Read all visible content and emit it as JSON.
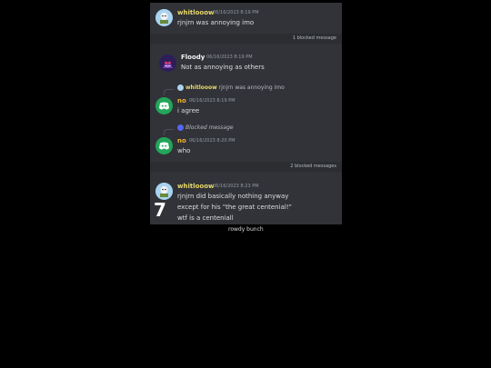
{
  "messages": [
    {
      "author": "whitlooow",
      "timestamp": "06/16/2023 8:19 PM",
      "lines": [
        "rjnjrn was annoying imo"
      ]
    },
    {
      "author": "Floody",
      "timestamp": "06/16/2023 8:19 PM",
      "lines": [
        "Not as annoying as others"
      ]
    },
    {
      "author": "no",
      "timestamp": "06/16/2023 8:19 PM",
      "lines": [
        "i agree"
      ]
    },
    {
      "author": "no",
      "timestamp": "06/16/2023 8:20 PM",
      "lines": [
        "who"
      ]
    },
    {
      "author": "whitlooow",
      "timestamp": "06/16/2023 8:23 PM",
      "lines": [
        "rjnjrn did basically nothing anyway",
        "except for his \"the great centenial!\"",
        "wtf is a centeniall"
      ]
    }
  ],
  "dividers": [
    "1 blocked message",
    "2 blocked messages"
  ],
  "replies": [
    {
      "author": "whitlooow",
      "text": "rjnjrn was annoying imo"
    },
    {
      "author": "",
      "text": "Blocked message"
    }
  ],
  "overlay_number": "7",
  "caption": "rowdy bunch",
  "colors": {
    "whitlooow": "#e8d96a",
    "floody": "#f2f3f5",
    "no": "#f0b232",
    "discord_green": "#23a55a"
  }
}
